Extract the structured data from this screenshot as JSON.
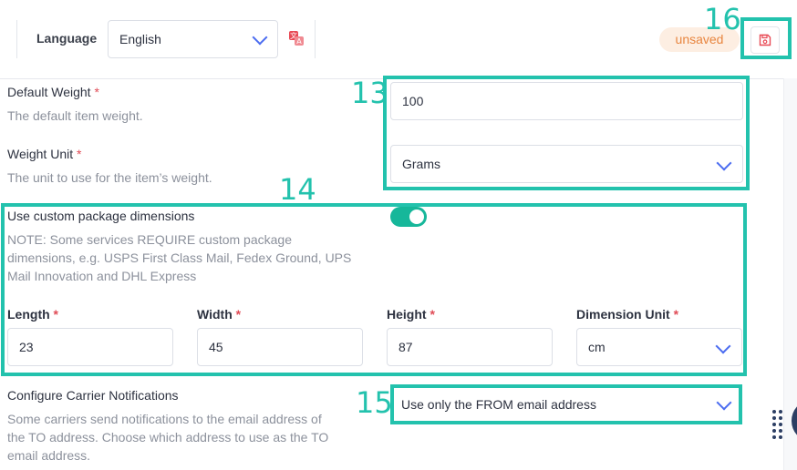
{
  "header": {
    "language_label": "Language",
    "language_value": "English",
    "status_badge": "unsaved",
    "annotation_save": "16"
  },
  "form": {
    "default_weight": {
      "label": "Default Weight",
      "required": "*",
      "help": "The default item weight.",
      "value": "100"
    },
    "weight_unit": {
      "label": "Weight Unit",
      "required": "*",
      "help": "The unit to use for the item’s weight.",
      "value": "Grams"
    },
    "custom_dimensions": {
      "label": "Use custom package dimensions",
      "enabled": true,
      "note_line1": "NOTE: Some services REQUIRE custom package",
      "note_line2": "dimensions, e.g. USPS First Class Mail, Fedex Ground, UPS",
      "note_line3": "Mail Innovation and DHL Express"
    },
    "length": {
      "label": "Length",
      "required": "*",
      "value": "23"
    },
    "width": {
      "label": "Width",
      "required": "*",
      "value": "45"
    },
    "height": {
      "label": "Height",
      "required": "*",
      "value": "87"
    },
    "dimension_unit": {
      "label": "Dimension Unit",
      "required": "*",
      "value": "cm"
    },
    "carrier_notifications": {
      "label": "Configure Carrier Notifications",
      "help_line1": "Some carriers send notifications to the email address of",
      "help_line2": "the TO address. Choose which address to use as the TO",
      "help_line3": "email address.",
      "value": "Use only the FROM email address"
    }
  },
  "annotations": {
    "weight_group": "13",
    "dimensions_group": "14",
    "carrier_select": "15"
  },
  "colors": {
    "accent": "#23c2ad",
    "toggle_on": "#16b79a",
    "chevron": "#4b6cf0",
    "required": "#e04b56",
    "badge_text": "#e8853f",
    "badge_bg": "#fdeee2"
  }
}
